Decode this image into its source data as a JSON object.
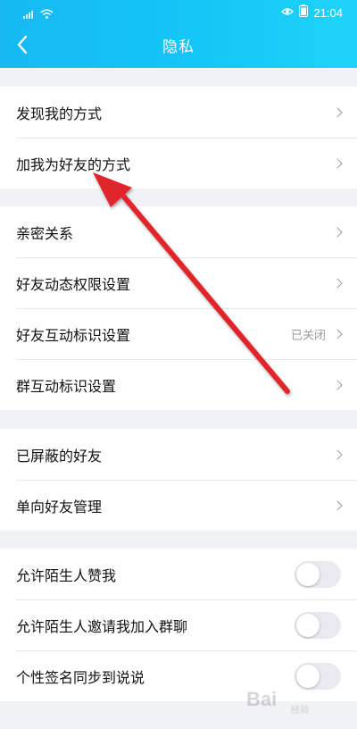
{
  "status_bar": {
    "time": "21:04"
  },
  "header": {
    "title": "隐私"
  },
  "groups": [
    {
      "items": [
        {
          "label": "发现我的方式"
        },
        {
          "label": "加我为好友的方式"
        }
      ]
    },
    {
      "items": [
        {
          "label": "亲密关系"
        },
        {
          "label": "好友动态权限设置"
        },
        {
          "label": "好友互动标识设置",
          "value": "已关闭"
        },
        {
          "label": "群互动标识设置"
        }
      ]
    },
    {
      "items": [
        {
          "label": "已屏蔽的好友"
        },
        {
          "label": "单向好友管理"
        }
      ]
    },
    {
      "items": [
        {
          "label": "允许陌生人赞我",
          "toggle": false
        },
        {
          "label": "允许陌生人邀请我加入群聊",
          "toggle": false
        },
        {
          "label": "个性签名同步到说说",
          "toggle": false
        }
      ]
    }
  ],
  "annotation": {
    "color": "#e0272b"
  },
  "watermark": {
    "text": "Bai",
    "subtext": "经验"
  }
}
